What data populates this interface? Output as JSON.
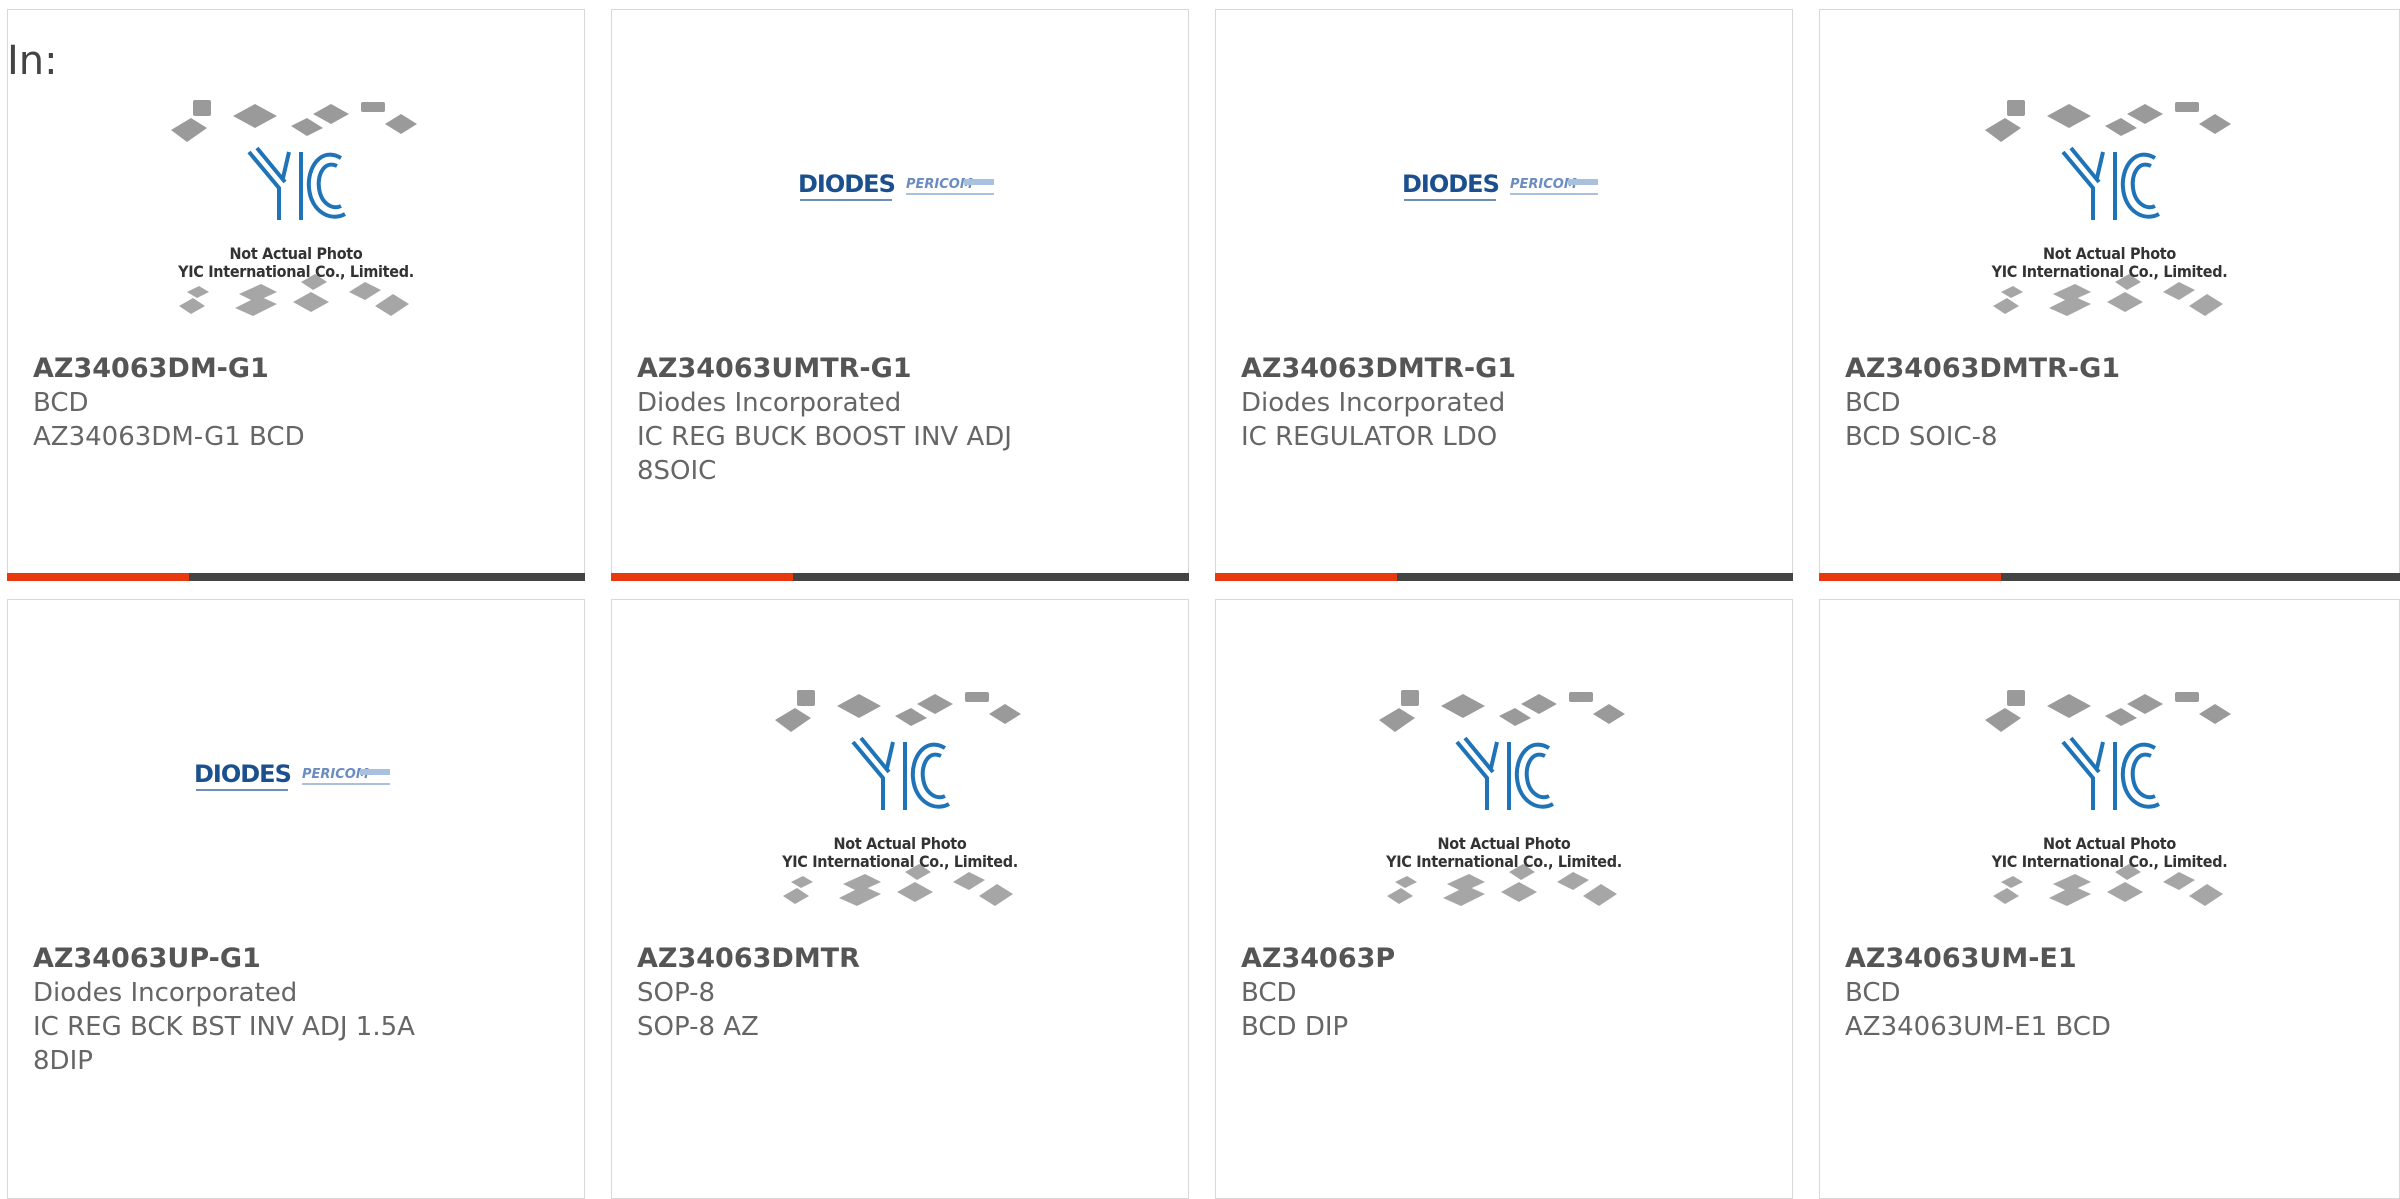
{
  "header": {
    "in_label": "In:"
  },
  "placeholder": {
    "line1": "Not Actual Photo",
    "line2": "YIC International Co., Limited."
  },
  "logo": {
    "diodes": "DIODES",
    "pericom": "PERICOM"
  },
  "colors": {
    "accent": "#e8380d",
    "bar": "#444444",
    "text": "#666666"
  },
  "products": [
    {
      "part": "AZ34063DM-G1",
      "manufacturer": "BCD",
      "description": "AZ34063DM-G1 BCD",
      "image": "yic-placeholder"
    },
    {
      "part": "AZ34063UMTR-G1",
      "manufacturer": "Diodes Incorporated",
      "description": "IC REG BUCK BOOST INV ADJ 8SOIC",
      "image": "diodes-logo"
    },
    {
      "part": "AZ34063DMTR-G1",
      "manufacturer": "Diodes Incorporated",
      "description": "IC REGULATOR LDO",
      "image": "diodes-logo"
    },
    {
      "part": "AZ34063DMTR-G1",
      "manufacturer": "BCD",
      "description": "BCD SOIC-8",
      "image": "yic-placeholder"
    },
    {
      "part": "AZ34063UP-G1",
      "manufacturer": "Diodes Incorporated",
      "description": "IC REG BCK BST INV ADJ 1.5A 8DIP",
      "image": "diodes-logo"
    },
    {
      "part": "AZ34063DMTR",
      "manufacturer": "SOP-8",
      "description": "SOP-8 AZ",
      "image": "yic-placeholder"
    },
    {
      "part": "AZ34063P",
      "manufacturer": "BCD",
      "description": "BCD DIP",
      "image": "yic-placeholder"
    },
    {
      "part": "AZ34063UM-E1",
      "manufacturer": "BCD",
      "description": "AZ34063UM-E1 BCD",
      "image": "yic-placeholder"
    }
  ]
}
